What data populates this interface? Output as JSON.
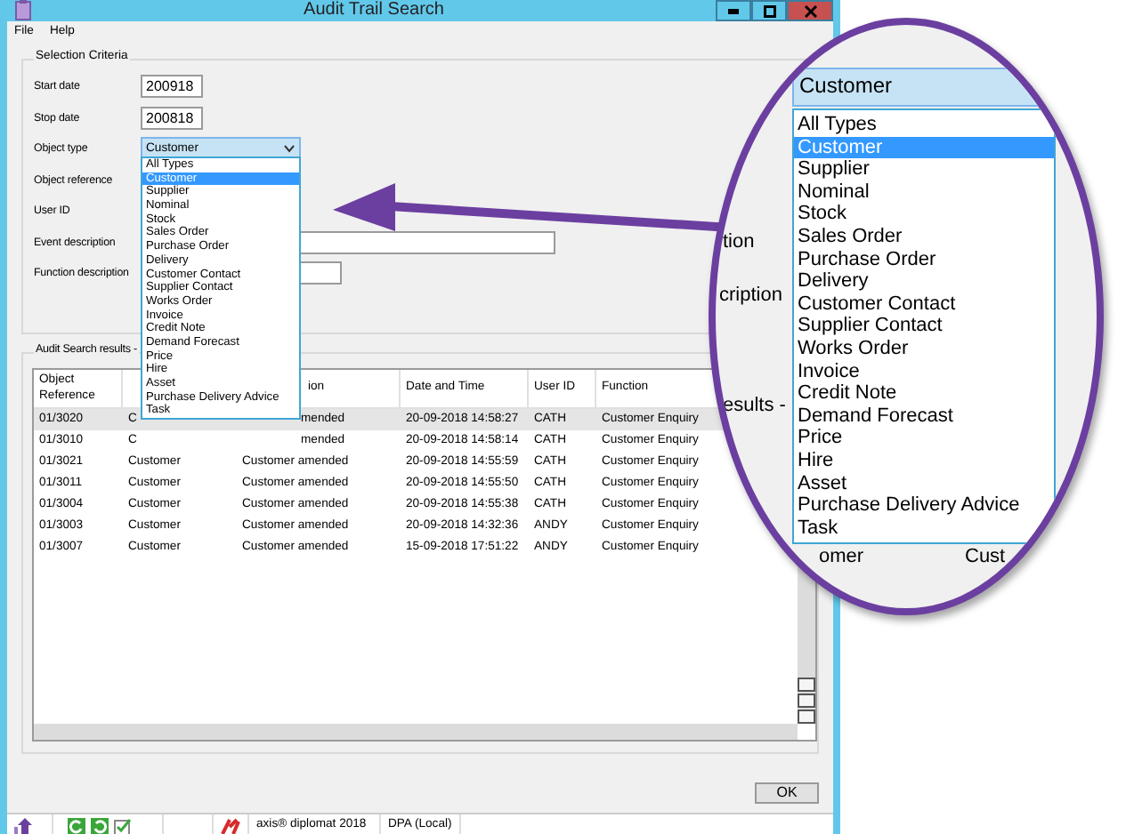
{
  "window": {
    "title": "Audit Trail Search"
  },
  "menu": [
    "File",
    "Help"
  ],
  "criteria": {
    "title": "Selection Criteria",
    "fields": [
      {
        "label": "Start date",
        "kind": "short",
        "value": "200918"
      },
      {
        "label": "Stop date",
        "kind": "short",
        "value": "200818"
      },
      {
        "label": "Object type",
        "kind": "combo",
        "value": "Customer",
        "focused": true
      },
      {
        "label": "Object reference",
        "kind": "covered"
      },
      {
        "label": "User ID",
        "kind": "covered"
      },
      {
        "label": "Event description",
        "kind": "wide"
      },
      {
        "label": "Function description",
        "kind": "medium"
      }
    ]
  },
  "dropdown": {
    "expanded": true,
    "options": [
      {
        "label": "All Types",
        "selected": false
      },
      {
        "label": "Customer",
        "selected": true
      },
      {
        "label": "Supplier",
        "selected": false
      },
      {
        "label": "Nominal",
        "selected": false
      },
      {
        "label": "Stock",
        "selected": false
      },
      {
        "label": "Sales Order",
        "selected": false
      },
      {
        "label": "Purchase Order",
        "selected": false
      },
      {
        "label": "Delivery",
        "selected": false
      },
      {
        "label": "Customer Contact",
        "selected": false
      },
      {
        "label": "Supplier Contact",
        "selected": false
      },
      {
        "label": "Works Order",
        "selected": false
      },
      {
        "label": "Invoice",
        "selected": false
      },
      {
        "label": "Credit Note",
        "selected": false
      },
      {
        "label": "Demand Forecast",
        "selected": false
      },
      {
        "label": "Price",
        "selected": false
      },
      {
        "label": "Hire",
        "selected": false
      },
      {
        "label": "Asset",
        "selected": false
      },
      {
        "label": "Purchase Delivery Advice",
        "selected": false
      },
      {
        "label": "Task",
        "selected": false
      }
    ]
  },
  "results": {
    "title": "Audit Search results -",
    "columns": [
      {
        "label": "Object Reference"
      },
      {},
      {
        "label": "ion"
      },
      {
        "label": "Date and Time"
      },
      {
        "label": "User ID"
      },
      {
        "label": "Function"
      }
    ],
    "rows": [
      {
        "selected": true,
        "cells": [
          "01/3020",
          "C",
          "mended",
          "20-09-2018 14:58:27",
          "CATH",
          "Customer Enquiry"
        ]
      },
      {
        "selected": false,
        "cells": [
          "01/3010",
          "C",
          "mended",
          "20-09-2018 14:58:14",
          "CATH",
          "Customer Enquiry"
        ]
      },
      {
        "selected": false,
        "cells": [
          "01/3021",
          "Customer",
          "Customer amended",
          "20-09-2018 14:55:59",
          "CATH",
          "Customer Enquiry"
        ]
      },
      {
        "selected": false,
        "cells": [
          "01/3011",
          "Customer",
          "Customer amended",
          "20-09-2018 14:55:50",
          "CATH",
          "Customer Enquiry"
        ]
      },
      {
        "selected": false,
        "cells": [
          "01/3004",
          "Customer",
          "Customer amended",
          "20-09-2018 14:55:38",
          "CATH",
          "Customer Enquiry"
        ]
      },
      {
        "selected": false,
        "cells": [
          "01/3003",
          "Customer",
          "Customer amended",
          "20-09-2018 14:32:36",
          "ANDY",
          "Customer Enquiry"
        ]
      },
      {
        "selected": false,
        "cells": [
          "01/3007",
          "Customer",
          "Customer amended",
          "15-09-2018 17:51:22",
          "ANDY",
          "Customer Enquiry"
        ]
      }
    ]
  },
  "buttons": [
    "OK"
  ],
  "status_bar": {
    "product": "axis® diplomat 2018",
    "connection": "DPA (Local)"
  },
  "magnifier": {
    "combo_value": "Customer",
    "fragments": [
      "tion",
      "cription",
      "esults -",
      "omer",
      "Cust"
    ],
    "options": [
      {
        "label": "All Types",
        "selected": false
      },
      {
        "label": "Customer",
        "selected": true
      },
      {
        "label": "Supplier",
        "selected": false
      },
      {
        "label": "Nominal",
        "selected": false
      },
      {
        "label": "Stock",
        "selected": false
      },
      {
        "label": "Sales Order",
        "selected": false
      },
      {
        "label": "Purchase Order",
        "selected": false
      },
      {
        "label": "Delivery",
        "selected": false
      },
      {
        "label": "Customer Contact",
        "selected": false
      },
      {
        "label": "Supplier Contact",
        "selected": false
      },
      {
        "label": "Works Order",
        "selected": false
      },
      {
        "label": "Invoice",
        "selected": false
      },
      {
        "label": "Credit Note",
        "selected": false
      },
      {
        "label": "Demand Forecast",
        "selected": false
      },
      {
        "label": "Price",
        "selected": false
      },
      {
        "label": "Hire",
        "selected": false
      },
      {
        "label": "Asset",
        "selected": false
      },
      {
        "label": "Purchase Delivery Advice",
        "selected": false
      },
      {
        "label": "Task",
        "selected": false
      }
    ]
  }
}
